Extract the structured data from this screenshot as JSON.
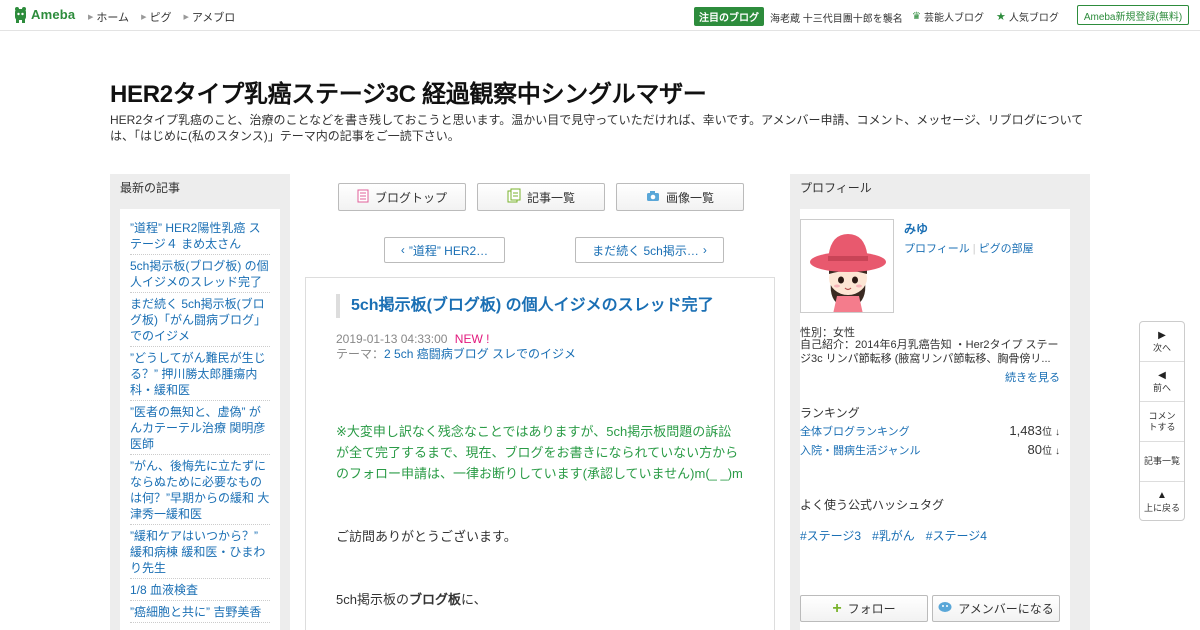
{
  "header": {
    "logo_text": "Ameba",
    "nav": [
      "ホーム",
      "ピグ",
      "アメブロ"
    ],
    "featured_badge": "注目のブログ",
    "featured_text": "海老蔵 十三代目團十郎を襲名",
    "celebrity_link": "芸能人ブログ",
    "popular_link": "人気ブログ",
    "register_button": "Ameba新規登録(無料)"
  },
  "blog": {
    "title": "HER2タイプ乳癌ステージ3C 経過観察中シングルマザー",
    "description": "HER2タイプ乳癌のこと、治療のことなどを書き残しておこうと思います。温かい目で見守っていただければ、幸いです。アメンバー申請、コメント、メッセージ、リブログについては、「はじめに(私のスタンス)」テーマ内の記事をご一読下さい。"
  },
  "left": {
    "heading": "最新の記事",
    "entries": [
      "”道程” HER2陽性乳癌 ステージ４ まめ太さん",
      "5ch掲示板(ブログ板) の個人イジメのスレッド完了",
      "まだ続く 5ch掲示板(ブログ板)「がん闘病ブログ」でのイジメ",
      "”どうしてがん難民が生じる？” 押川勝太郎腫瘍内科・緩和医",
      "”医者の無知と、虚偽” がんカテーテル治療 関明彦医師",
      "”がん、後悔先に立たずにならぬために必要なものは何？”早期からの緩和 大津秀一緩和医",
      "”緩和ケアはいつから？” 緩和病棟 緩和医・ひまわり先生",
      "1/8 血液検査",
      "”癌細胞と共に” 吉野美香"
    ]
  },
  "center": {
    "buttons": [
      "ブログトップ",
      "記事一覧",
      "画像一覧"
    ],
    "prev_label": "”道程” HER2…",
    "next_label": "まだ続く 5ch掲示…",
    "article": {
      "title": "5ch掲示板(ブログ板) の個人イジメのスレッド完了",
      "date": "2019-01-13 04:33:00",
      "new_badge": "NEW !",
      "theme_prefix": "テーマ：",
      "theme": "2 5ch 癌闘病ブログ スレでのイジメ",
      "notice_1": "※大変申し訳なく残念なことではありますが、5ch掲示板問題の訴訟",
      "notice_2": "が全て完了するまで、現在、ブログをお書きになられていない方から",
      "notice_3": "のフォロー申請は、一律お断りしています(承認していません)m(_ _)m",
      "greeting": "ご訪問ありがとうございます。",
      "line_start": "5ch掲示板の",
      "line_bold": "ブログ板",
      "line_end": "に、"
    }
  },
  "right": {
    "heading": "プロフィール",
    "name": "みゆ",
    "profile_link": "プロフィール",
    "pig_link": "ピグの部屋",
    "sex": "性別：女性",
    "intro": "自己紹介：2014年6月乳癌告知 ・Her2タイプ ステージ3c リンパ節転移 (腋窩リンパ節転移、胸骨傍リ...",
    "more": "続きを見る",
    "ranking_heading": "ランキング",
    "ranking": [
      {
        "label": "全体ブログランキング",
        "value": "1,483",
        "unit": "位",
        "arrow": "↓"
      },
      {
        "label": "入院・闘病生活ジャンル",
        "value": "80",
        "unit": "位",
        "arrow": "↓"
      }
    ],
    "hashtag_heading": "よく使う公式ハッシュタグ",
    "hashtags": [
      "#ステージ3",
      "#乳がん",
      "#ステージ4"
    ],
    "follow_button": "フォロー",
    "amember_button": "アメンバーになる"
  },
  "float_nav": [
    "次へ",
    "前へ",
    "コメントする",
    "記事一覧",
    "上に戻る"
  ],
  "colors": {
    "brand_green": "#2d8c3c",
    "link_blue": "#1a6fb4",
    "notice_green": "#2a9b46",
    "new_pink": "#e2197d"
  }
}
